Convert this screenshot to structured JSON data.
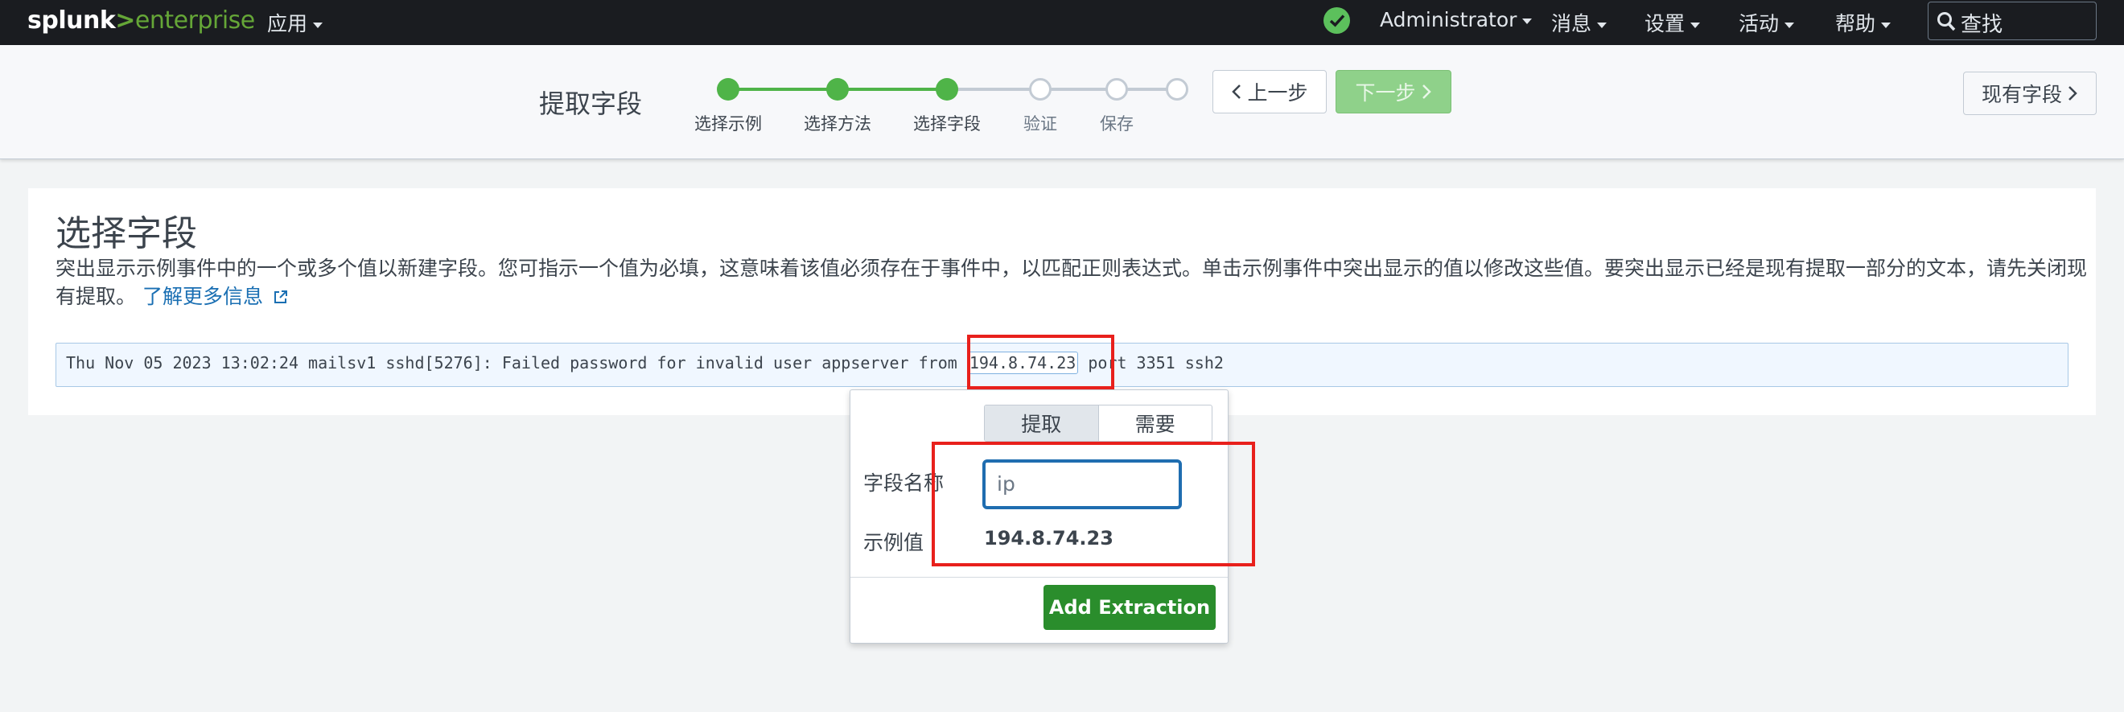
{
  "topbar": {
    "logo_part1": "splunk",
    "logo_part2": ">",
    "logo_part3": "enterprise",
    "apps": "应用",
    "user": "Administrator",
    "messages": "消息",
    "settings": "设置",
    "activity": "活动",
    "help": "帮助",
    "search_placeholder": "查找",
    "health_color": "#5cc05c"
  },
  "wizard": {
    "title": "提取字段",
    "steps": [
      {
        "label": "选择示例",
        "state": "done"
      },
      {
        "label": "选择方法",
        "state": "done"
      },
      {
        "label": "选择字段",
        "state": "done"
      },
      {
        "label": "验证",
        "state": "todo"
      },
      {
        "label": "保存",
        "state": "todo"
      },
      {
        "label": "",
        "state": "todo"
      }
    ],
    "prev_label": "上一步",
    "next_label": "下一步",
    "existing_fields_label": "现有字段"
  },
  "panel": {
    "title": "选择字段",
    "description": "突出显示示例事件中的一个或多个值以新建字段。您可指示一个值为必填，这意味着该值必须存在于事件中，以匹配正则表达式。单击示例事件中突出显示的值以修改这些值。要突出显示已经是现有提取一部分的文本，请先关闭现有提取。",
    "learn_more": "了解更多信息",
    "event_before": "Thu Nov 05 2023 13:02:24 mailsv1 sshd[5276]: Failed password for invalid user appserver from ",
    "event_highlight": "194.8.74.23",
    "event_after": " port 3351 ssh2"
  },
  "popover": {
    "tab_extract": "提取",
    "tab_require": "需要",
    "field_name_label": "字段名称",
    "field_name_value": "ip",
    "sample_value_label": "示例值",
    "sample_value": "194.8.74.23",
    "add_button": "Add Extraction"
  },
  "colors": {
    "accent_green": "#4fb448",
    "annotation_red": "#e8201c",
    "link_blue": "#1a6fb3"
  }
}
